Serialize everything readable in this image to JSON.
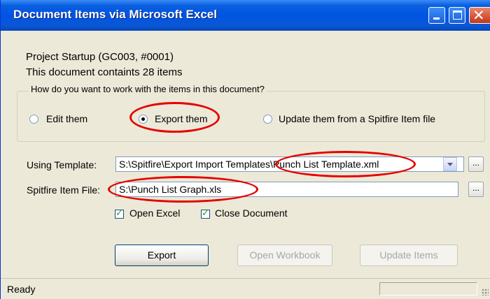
{
  "window": {
    "title": "Document Items via Microsoft Excel",
    "controls": {
      "minimize_icon": "minimize-icon",
      "maximize_icon": "maximize-icon",
      "close_icon": "close-icon",
      "close_glyph": "✕"
    }
  },
  "document": {
    "title": "Project Startup (GC003, #0001)",
    "item_count_text": "This document containts 28 items"
  },
  "mode_group": {
    "label": "How do you want to work with the items in this document?",
    "options": [
      {
        "label": "Edit them",
        "selected": false
      },
      {
        "label": "Export them",
        "selected": true
      },
      {
        "label": "Update them from a Spitfire Item file",
        "selected": false
      }
    ]
  },
  "template": {
    "label": "Using Template:",
    "value": "S:\\Spitfire\\Export Import Templates\\Punch List Template.xml",
    "browse_label": "..."
  },
  "item_file": {
    "label": "Spitfire Item File:",
    "value": "S:\\Punch List Graph.xls",
    "browse_label": "..."
  },
  "options": {
    "open_excel": {
      "label": "Open Excel",
      "checked": true
    },
    "close_document": {
      "label": "Close Document",
      "checked": true
    }
  },
  "buttons": {
    "export": "Export",
    "open_workbook": "Open Workbook",
    "update_items": "Update Items"
  },
  "status": {
    "text": "Ready"
  },
  "colors": {
    "title_bar": "#0054E3",
    "dialog_bg": "#ECE9D8",
    "annotation": "#E60000",
    "close_button": "#C4361A"
  }
}
